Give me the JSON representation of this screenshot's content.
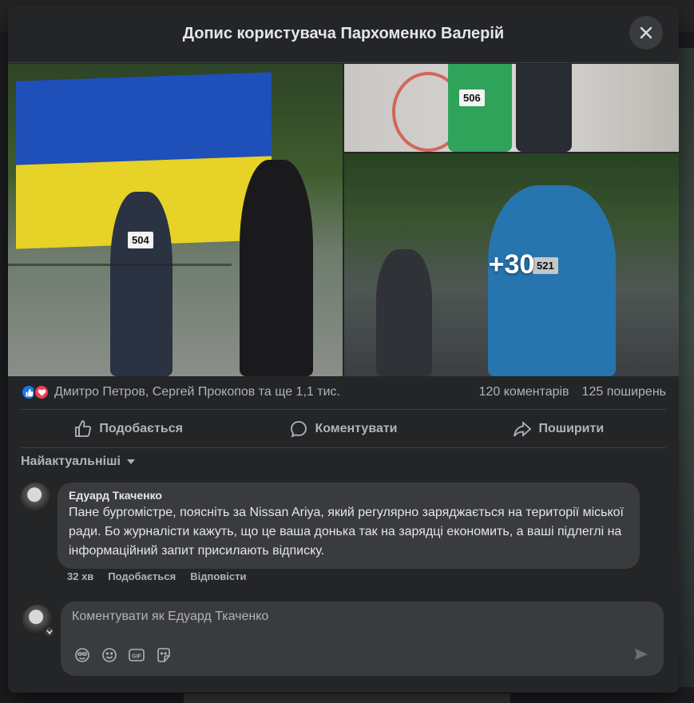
{
  "modal": {
    "title": "Допис користувача Пархоменко Валерій"
  },
  "photos": {
    "more_count": "+30",
    "bibs": [
      "504",
      "506",
      "521"
    ]
  },
  "reactions": {
    "reactors": "Дмитро Петров, Сергей Прокопов та ще 1,1 тис.",
    "comments_count": "120 коментарів",
    "shares_count": "125 поширень"
  },
  "actions": {
    "like": "Подобається",
    "comment": "Коментувати",
    "share": "Поширити"
  },
  "sort": {
    "label": "Найактуальніші"
  },
  "comment": {
    "author": "Едуард Ткаченко",
    "text": "Пане бургомістре, поясніть за Nissan Ariya, який регулярно заряджається на території міської ради. Бо журналісти кажуть, що це ваша донька так на зарядці економить, а ваші підлеглі на інформаційний запит присилають відписку.",
    "time": "32 хв",
    "like": "Подобається",
    "reply": "Відповісти"
  },
  "composer": {
    "placeholder": "Коментувати як Едуард Ткаченко"
  },
  "icons": [
    "close-icon",
    "like-icon",
    "love-icon",
    "thumbs-up-icon",
    "comment-icon",
    "share-icon",
    "chevron-down-icon",
    "avatar-icon",
    "sticker-icon",
    "emoji-icon",
    "gif-icon",
    "sticker2-icon",
    "send-icon"
  ]
}
